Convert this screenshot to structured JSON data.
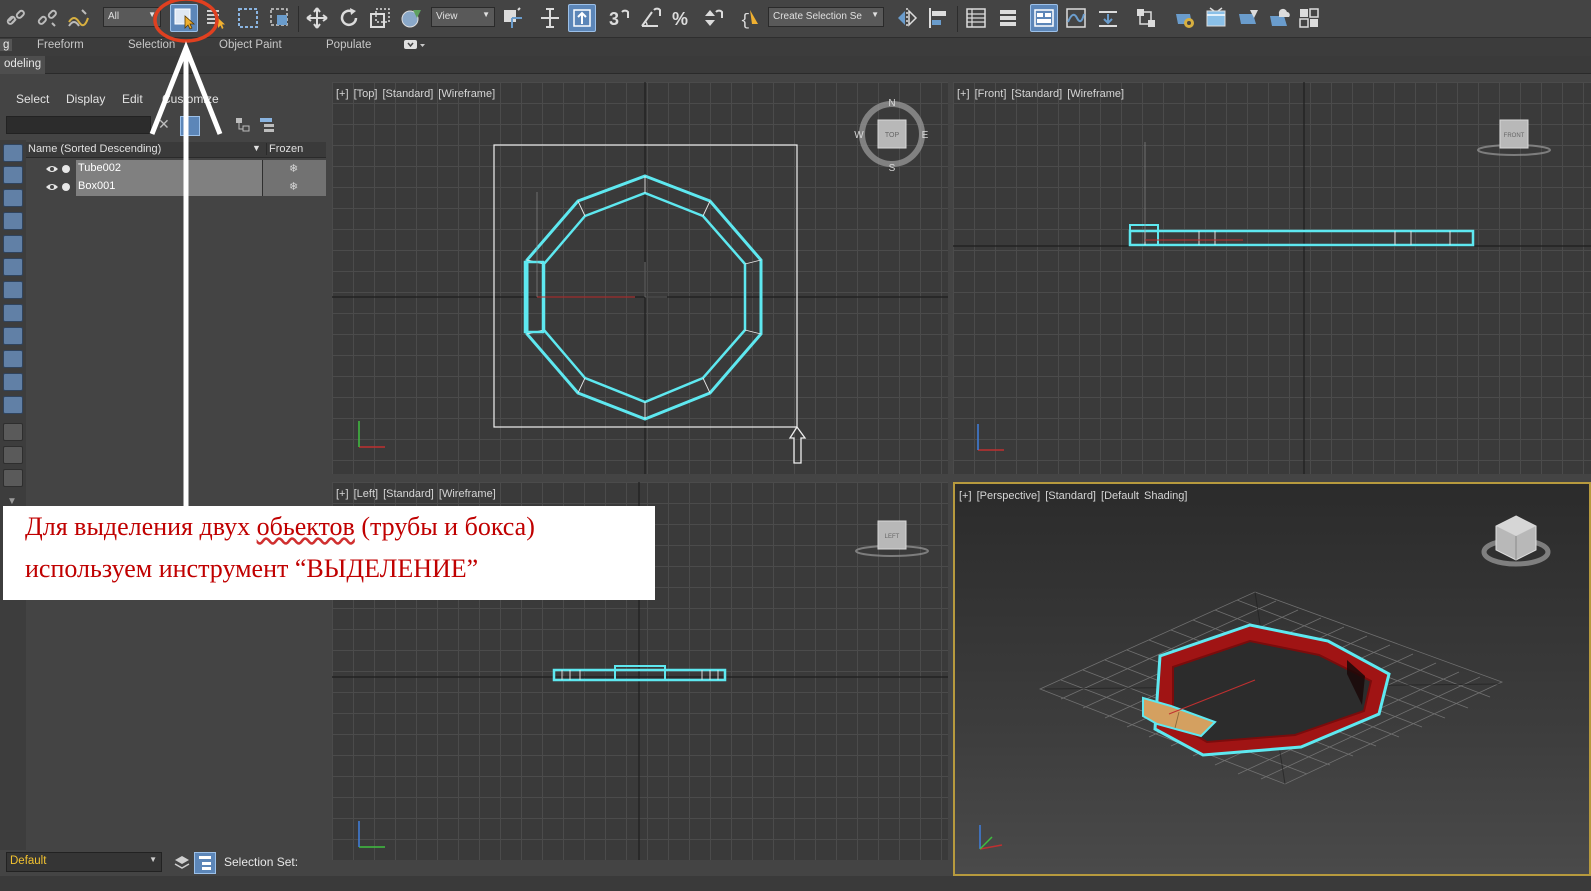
{
  "toolbar": {
    "filter_value": "All",
    "view_value": "View",
    "selection_set_value": "Create Selection Se",
    "select_object_tool": "Select Object"
  },
  "ribbon": {
    "tabs": [
      "g",
      "Freeform",
      "Selection",
      "Object Paint",
      "Populate"
    ],
    "subtab": "odeling"
  },
  "explorer": {
    "menu": [
      "Select",
      "Display",
      "Edit",
      "Customize"
    ],
    "column_name": "Name (Sorted Descending)",
    "column_frozen": "Frozen",
    "rows": [
      {
        "name": "Tube002",
        "frozen": "❄"
      },
      {
        "name": "Box001",
        "frozen": "❄"
      }
    ]
  },
  "bottom": {
    "layer": "Default",
    "selection_set_label": "Selection Set:"
  },
  "viewports": {
    "top": "[+] [Top] [Standard] [Wireframe]",
    "front": "[+] [Front] [Standard] [Wireframe]",
    "left": "[+] [Left] [Standard] [Wireframe]",
    "perspective": "[+] [Perspective] [Standard] [Default Shading]"
  },
  "viewcube": {
    "top": "TOP",
    "front": "FRONT",
    "left": "LEFT",
    "north": "N",
    "south": "S",
    "east": "E",
    "west": "W"
  },
  "annotation": {
    "line1_part1": "Для выделения двух ",
    "line1_underlined": "обьектов",
    "line1_part2": " (трубы и бокса)",
    "line2": "используем инструмент “ВЫДЕЛЕНИЕ”"
  },
  "colors": {
    "selection_wire": "#5ee8f0",
    "tube": "#b01818",
    "box": "#d4a060",
    "annotation_text": "#c00000",
    "highlight_circle": "#e04020",
    "active_viewport_border": "#b79a3e"
  }
}
